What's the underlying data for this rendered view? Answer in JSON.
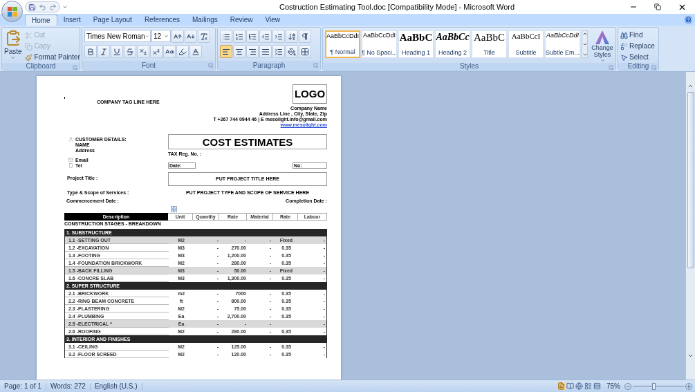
{
  "window": {
    "title": "Costruction Estimating Tool.doc [Compatibility Mode] - Microsoft Word"
  },
  "tabs": [
    {
      "label": "Home",
      "selected": true
    },
    {
      "label": "Insert",
      "selected": false
    },
    {
      "label": "Page Layout",
      "selected": false
    },
    {
      "label": "References",
      "selected": false
    },
    {
      "label": "Mailings",
      "selected": false
    },
    {
      "label": "Review",
      "selected": false
    },
    {
      "label": "View",
      "selected": false
    }
  ],
  "ribbon": {
    "clipboard": {
      "label": "Clipboard",
      "paste": "Paste",
      "cut": {
        "label": "Cut",
        "disabled": true
      },
      "copy": {
        "label": "Copy",
        "disabled": true
      },
      "format_painter": {
        "label": "Format Painter",
        "disabled": false
      }
    },
    "font": {
      "label": "Font",
      "family": "Times New Roman",
      "size": "12"
    },
    "paragraph": {
      "label": "Paragraph",
      "align_buttons": [
        {
          "kind": "left",
          "selected": true
        },
        {
          "kind": "center",
          "selected": false
        },
        {
          "kind": "right",
          "selected": false
        },
        {
          "kind": "justify",
          "selected": false
        }
      ]
    },
    "styles": {
      "label": "Styles",
      "change_styles": "Change Styles",
      "items": [
        {
          "preview": "AaBbCcDdI",
          "name": "¶ Normal",
          "kind": "normal",
          "selected": true
        },
        {
          "preview": "AaBbCcDdI",
          "name": "¶ No Spaci...",
          "kind": "normal",
          "selected": false
        },
        {
          "preview": "AaBbC",
          "name": "Heading 1",
          "kind": "heading1",
          "selected": false
        },
        {
          "preview": "AaBbCc",
          "name": "Heading 2",
          "kind": "heading2",
          "selected": false
        },
        {
          "preview": "AaBbC",
          "name": "Title",
          "kind": "title",
          "selected": false
        },
        {
          "preview": "AaBbCcI",
          "name": "Subtitle",
          "kind": "subtitle",
          "selected": false
        },
        {
          "preview": "AaBbCcDdI",
          "name": "Subtle Em...",
          "kind": "emphasis",
          "selected": false
        }
      ]
    },
    "editing": {
      "label": "Editing",
      "find": "Find",
      "replace": "Replace",
      "select": "Select"
    }
  },
  "document": {
    "tagline": "COMPANY TAG LINE HERE",
    "logo": "LOGO",
    "company": [
      "Company Name",
      "Address Line , City, State, Zip",
      "T +267 744 0944 46 | E mesolight.info@gmail.com"
    ],
    "website": "www.mesolight.com",
    "customer": {
      "heading": "CUSTOMER DETAILS:",
      "name": "NAME",
      "address": "Address",
      "email": "Email",
      "tel": "Tel"
    },
    "title": "COST ESTIMATES",
    "tax": "TAX Reg. No. :",
    "date": "Date:",
    "number": "No:",
    "project_label": "Project Title :",
    "project_value": "PUT PROJECT TITLE HERE",
    "scope_label": "Type & Scope of Services :",
    "scope_value": "PUT PROJECT TYPE AND SCOPE OF SERVICE HERE",
    "commencement": "Commencement Date :",
    "completion": "Completion Date :",
    "table": {
      "columns": [
        "Description",
        "Unit",
        "Quantity",
        "Rate",
        "Material",
        "Rate",
        "Labour"
      ],
      "caption": "CONSTRUCTION STAGES - BREAKDOWN",
      "sections": [
        {
          "title": "1. SUBSTRUCTURE",
          "rows": [
            {
              "description": "1.1 -SETTING OUT",
              "unit": "M2",
              "quantity": "-",
              "rate": "-",
              "material": "-",
              "rate_2": "Fixed",
              "labour": "-",
              "shaded": true
            },
            {
              "description": "1.2 -EXCAVATION",
              "unit": "M3",
              "quantity": "-",
              "rate": "270.00",
              "material": "-",
              "rate_2": "0.35",
              "labour": "-",
              "shaded": false
            },
            {
              "description": "1.3 -FOOTING",
              "unit": "M3",
              "quantity": "-",
              "rate": "1,200.00",
              "material": "-",
              "rate_2": "0.35",
              "labour": "-",
              "shaded": false
            },
            {
              "description": "1.4 -FOUNDATION BRICKWORK",
              "unit": "M2",
              "quantity": "-",
              "rate": "280.00",
              "material": "-",
              "rate_2": "0.35",
              "labour": "-",
              "shaded": false
            },
            {
              "description": "1.5 -BACK FILLING",
              "unit": "M3",
              "quantity": "-",
              "rate": "50.00",
              "material": "-",
              "rate_2": "Fixed",
              "labour": "-",
              "shaded": true
            },
            {
              "description": "1.6 -CONCRE SLAB",
              "unit": "M3",
              "quantity": "-",
              "rate": "1,300.00",
              "material": "-",
              "rate_2": "0.35",
              "labour": "-",
              "shaded": false
            }
          ]
        },
        {
          "title": "2. SUPER STRUCTURE",
          "rows": [
            {
              "description": "2.1 -BRICKWORK",
              "unit": "m2",
              "quantity": "-",
              "rate": "7000",
              "material": "-",
              "rate_2": "0.35",
              "labour": "-",
              "shaded": false
            },
            {
              "description": "2.2 -RING BEAM CONCRETE",
              "unit": "ft",
              "quantity": "-",
              "rate": "800.00",
              "material": "-",
              "rate_2": "0.35",
              "labour": "-",
              "shaded": false
            },
            {
              "description": "2.3 -PLASTERING",
              "unit": "M2",
              "quantity": "-",
              "rate": "75.00",
              "material": "-",
              "rate_2": "0.35",
              "labour": "-",
              "shaded": false
            },
            {
              "description": "2.4 -PLUMBING",
              "unit": "Ea",
              "quantity": "-",
              "rate": "2,700.00",
              "material": "-",
              "rate_2": "0.35",
              "labour": "-",
              "shaded": false
            },
            {
              "description": "2.5 -ELECTRICAL *",
              "unit": "Ea",
              "quantity": "-",
              "rate": "-",
              "material": "-",
              "labour": "-",
              "shaded": true
            },
            {
              "description": "2.6 -ROOFING",
              "unit": "M2",
              "quantity": "-",
              "rate": "280.00",
              "material": "-",
              "rate_2": "0.35",
              "labour": "-",
              "shaded": false
            }
          ]
        },
        {
          "title": "3. INTERIOR AND FINISHES",
          "rows": [
            {
              "description": "3.1 -CEILING",
              "unit": "M2",
              "quantity": "-",
              "rate": "125.00",
              "material": "-",
              "rate_2": "0.35",
              "labour": "-",
              "shaded": false
            },
            {
              "description": "3.2 -FLOOR SCREED",
              "unit": "M2",
              "quantity": "-",
              "rate": "120.00",
              "material": "-",
              "rate_2": "0.35",
              "labour": "-",
              "shaded": false
            }
          ]
        }
      ]
    }
  },
  "status_bar": {
    "page": "Page: 1 of 1",
    "words": "Words: 272",
    "language": "English (U.S.)",
    "zoom": "75%",
    "zoom_slider": {
      "level": 0.4
    }
  }
}
